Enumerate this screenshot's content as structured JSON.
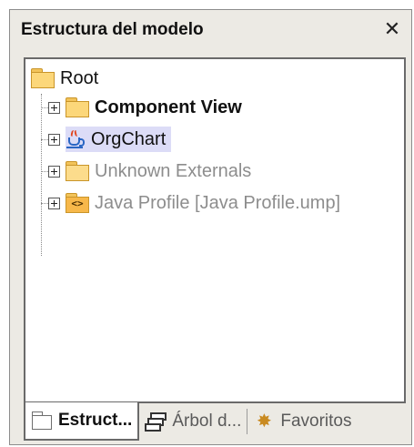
{
  "panel": {
    "title": "Estructura del modelo",
    "close_glyph": "✕"
  },
  "tree": {
    "root": {
      "label": "Root",
      "icon": "folder-icon"
    },
    "children": [
      {
        "label": "Component View",
        "icon": "folder-icon",
        "state": "normal",
        "bold": true
      },
      {
        "label": "OrgChart",
        "icon": "java-icon",
        "state": "selected",
        "bold": false
      },
      {
        "label": "Unknown Externals",
        "icon": "folder-icon",
        "state": "disabled",
        "bold": false
      },
      {
        "label": "Java Profile [Java Profile.ump]",
        "icon": "profile-icon",
        "state": "disabled",
        "bold": false
      }
    ]
  },
  "tabs": [
    {
      "label": "Estruct...",
      "icon": "folder-outline-icon",
      "active": true
    },
    {
      "label": "Árbol d...",
      "icon": "tree-hierarchy-icon",
      "active": false
    },
    {
      "label": "Favoritos",
      "icon": "favorites-star-icon",
      "active": false
    }
  ],
  "colors": {
    "panel_bg": "#eceae4",
    "selection": "#dcdcf7",
    "folder": "#fcd77a",
    "disabled_text": "#8d8d8d"
  }
}
